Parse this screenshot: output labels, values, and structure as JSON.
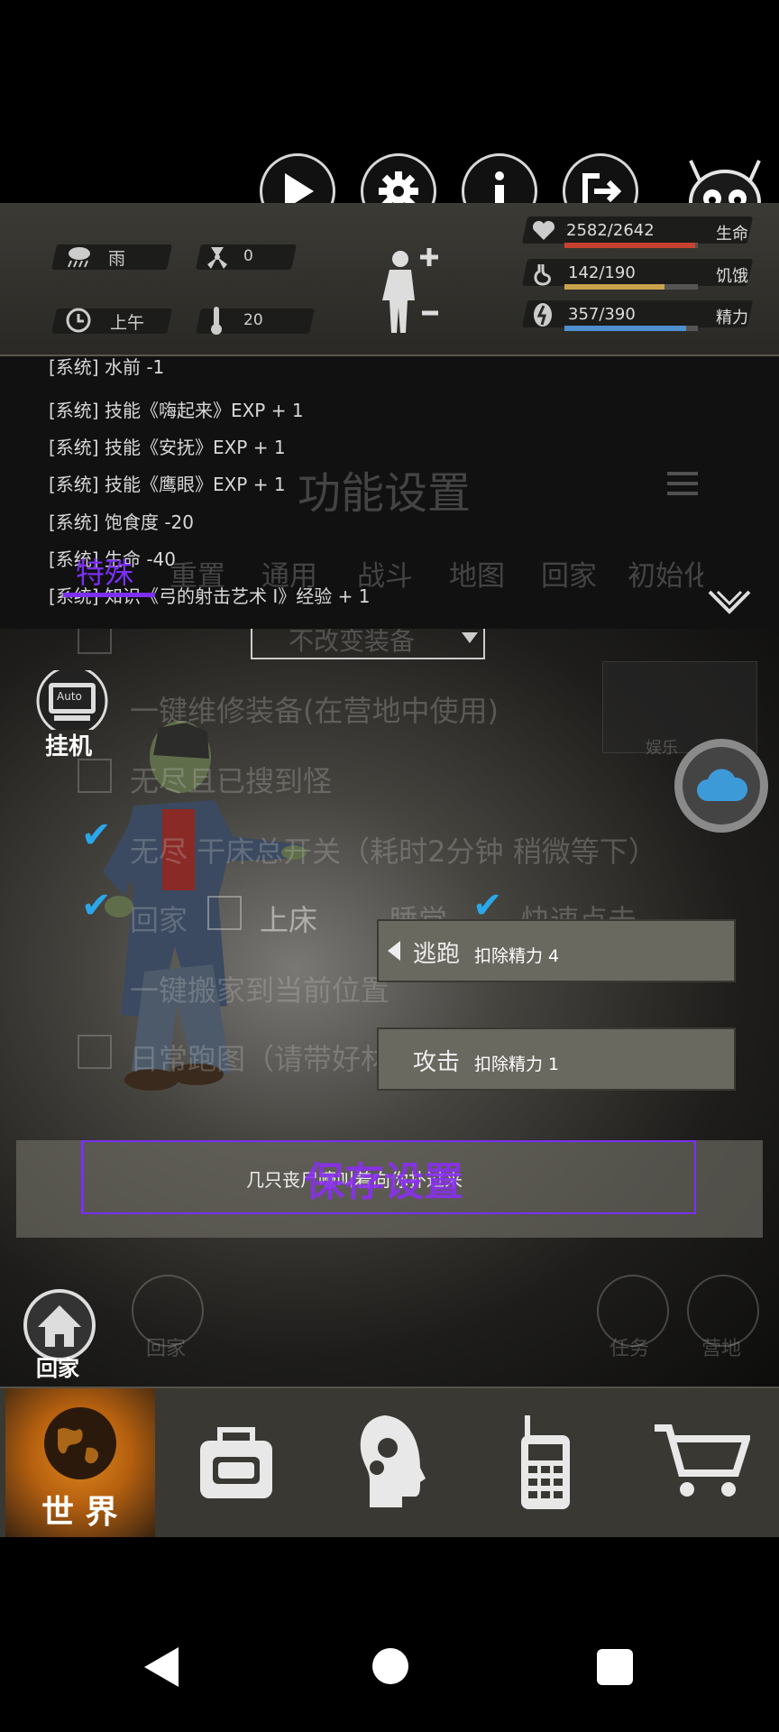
{
  "weather": {
    "condition": "雨",
    "radiation": "0",
    "time_of_day": "上午",
    "temperature": "20"
  },
  "stats": {
    "health": {
      "value": "2582/2642",
      "label": "生命",
      "fraction": 0.977,
      "color": "#c9412f"
    },
    "hunger": {
      "value": "142/190",
      "label": "饥饿",
      "fraction": 0.747,
      "color": "#c9a24a"
    },
    "stamina": {
      "value": "357/390",
      "label": "精力",
      "fraction": 0.915,
      "color": "#4f8fd0"
    }
  },
  "toolbar": {
    "start": "启动",
    "settings": "设置",
    "help": "说明",
    "exit": "退出"
  },
  "log": [
    "[系统] 水前 -1",
    "[系统] 技能《嗨起来》EXP + 1",
    "[系统] 技能《安抚》EXP + 1",
    "[系统] 技能《鹰眼》EXP + 1",
    "[系统] 饱食度 -20",
    "[系统] 生命 -40",
    "[系统] 知识《弓的射击艺术 I》经验 + 1"
  ],
  "settings_dialog": {
    "title": "功能设置",
    "tabs": [
      "特殊",
      "重置",
      "通用",
      "战斗",
      "地图",
      "回家",
      "初始化"
    ],
    "dropdown_value": "不改变装备",
    "options": [
      "一键维修装备(在营地中使用)",
      "无尽且已搜到怪",
      "无尽 干床总开关（耗时2分钟 稍微等下）",
      "一键搬家到当前位置",
      "日常跑图（请带好材料）"
    ],
    "inline_options": {
      "go_home": "回家",
      "bed": "上床",
      "sleep": "睡觉",
      "quick_click": "快速点击"
    },
    "save_button": "保存设置",
    "auto_label": "挂机"
  },
  "actions": [
    {
      "label": "逃跑",
      "cost": "扣除精力 4"
    },
    {
      "label": "攻击",
      "cost": "扣除精力 1"
    }
  ],
  "encounter_message": "几只丧尸嚎叫着向你扑过来",
  "home_label": "回家",
  "faint_scene_labels": {
    "mission": "任务",
    "camp": "营地",
    "home": "回家",
    "entertainment": "娱乐"
  },
  "bottom_nav": {
    "world": "世 界"
  },
  "colors": {
    "accent_purple": "#7b2ff7",
    "check_blue": "#2aa7ea",
    "world_orange": "#e0871e"
  }
}
